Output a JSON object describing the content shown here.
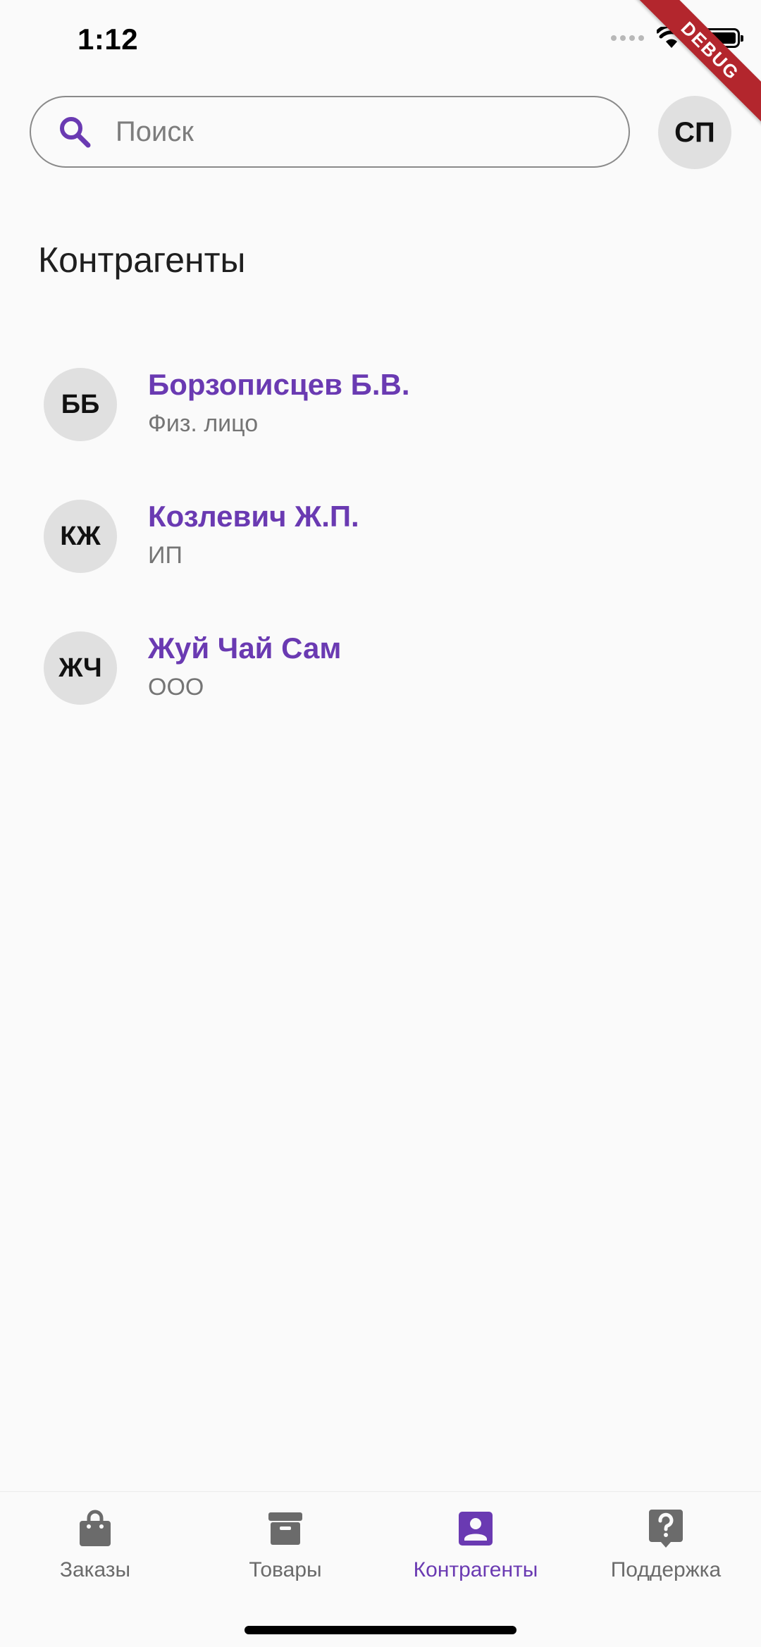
{
  "status_bar": {
    "time": "1:12"
  },
  "debug_ribbon": "DEBUG",
  "search": {
    "placeholder": "Поиск"
  },
  "profile": {
    "initials": "СП"
  },
  "page": {
    "title": "Контрагенты"
  },
  "contacts": [
    {
      "initials": "ББ",
      "name": "Борзописцев Б.В.",
      "type": "Физ. лицо"
    },
    {
      "initials": "КЖ",
      "name": "Козлевич Ж.П.",
      "type": "ИП"
    },
    {
      "initials": "ЖЧ",
      "name": "Жуй Чай Сам",
      "type": "ООО"
    }
  ],
  "bottom_nav": {
    "items": [
      {
        "label": "Заказы",
        "icon": "shopping-bag-icon"
      },
      {
        "label": "Товары",
        "icon": "box-icon"
      },
      {
        "label": "Контрагенты",
        "icon": "contact-card-icon",
        "active": true
      },
      {
        "label": "Поддержка",
        "icon": "help-bubble-icon"
      }
    ]
  },
  "colors": {
    "accent": "#6a3ab2",
    "inactive": "#6b6b6b",
    "avatar_bg": "#e0e0e0",
    "background": "#fafafa",
    "debug": "#b3262d"
  }
}
